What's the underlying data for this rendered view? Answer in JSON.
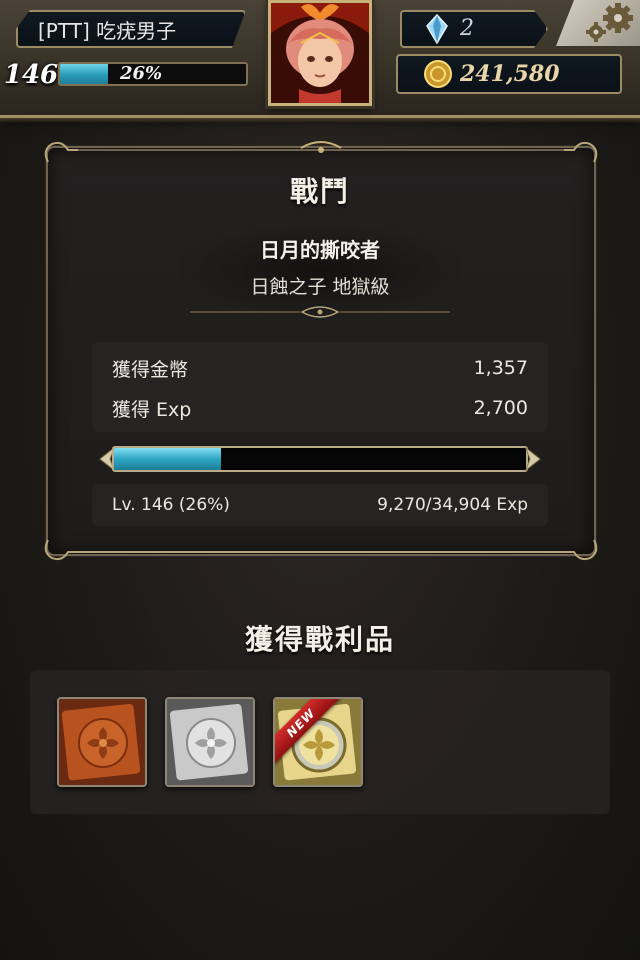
{
  "hud": {
    "player_name": "[PTT] 吃疣男子",
    "level": "146",
    "xp_percent_label": "26%",
    "xp_fraction": 0.26,
    "gems": "2",
    "gold": "241,580"
  },
  "battle": {
    "title": "戰鬥",
    "stage_name": "日月的撕咬者",
    "stage_sub": "日蝕之子 地獄級",
    "rewards": [
      {
        "label": "獲得金幣",
        "value": "1,357"
      },
      {
        "label": "獲得 Exp",
        "value": "2,700"
      }
    ],
    "exp_fraction": 0.26,
    "level_text": "Lv. 146 (26%)",
    "exp_text": "9,270/34,904 Exp"
  },
  "loot": {
    "title": "獲得戰利品",
    "items": [
      {
        "name": "bronze-card",
        "is_new": false
      },
      {
        "name": "silver-card",
        "is_new": false
      },
      {
        "name": "gold-card",
        "is_new": true,
        "badge": "NEW"
      }
    ]
  },
  "colors": {
    "exp_bar": "#2ea7c4",
    "gold_text": "#e8d6a8",
    "frame": "#9b8a62"
  }
}
